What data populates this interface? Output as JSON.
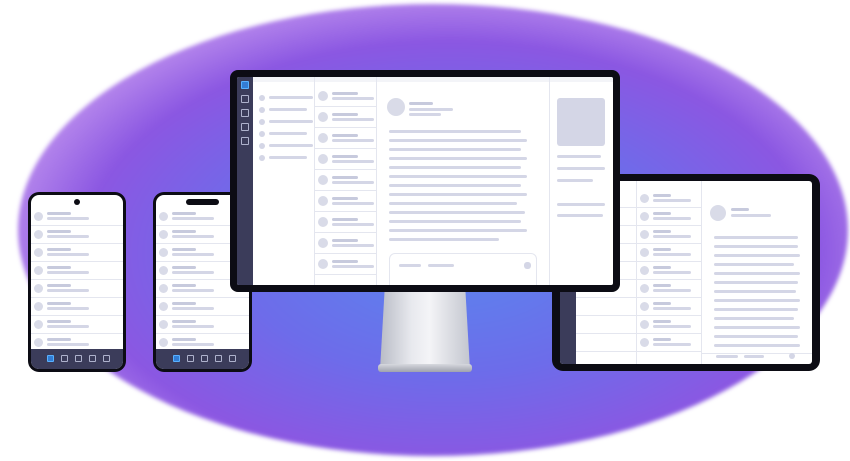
{
  "illustration": {
    "devices": [
      "phone-small",
      "phone-notch",
      "desktop-monitor",
      "tablet"
    ],
    "colors": {
      "glow_center": "#5a86ee",
      "glow_edge": "#8b57e2",
      "device_frame": "#0c0c14",
      "nav_sidebar": "#3b3c5a",
      "active_icon": "#3b78d0",
      "placeholder_bar": "#d4d6e6"
    },
    "icons": [
      "square-nav-icon",
      "avatar-circle",
      "image-placeholder"
    ]
  }
}
